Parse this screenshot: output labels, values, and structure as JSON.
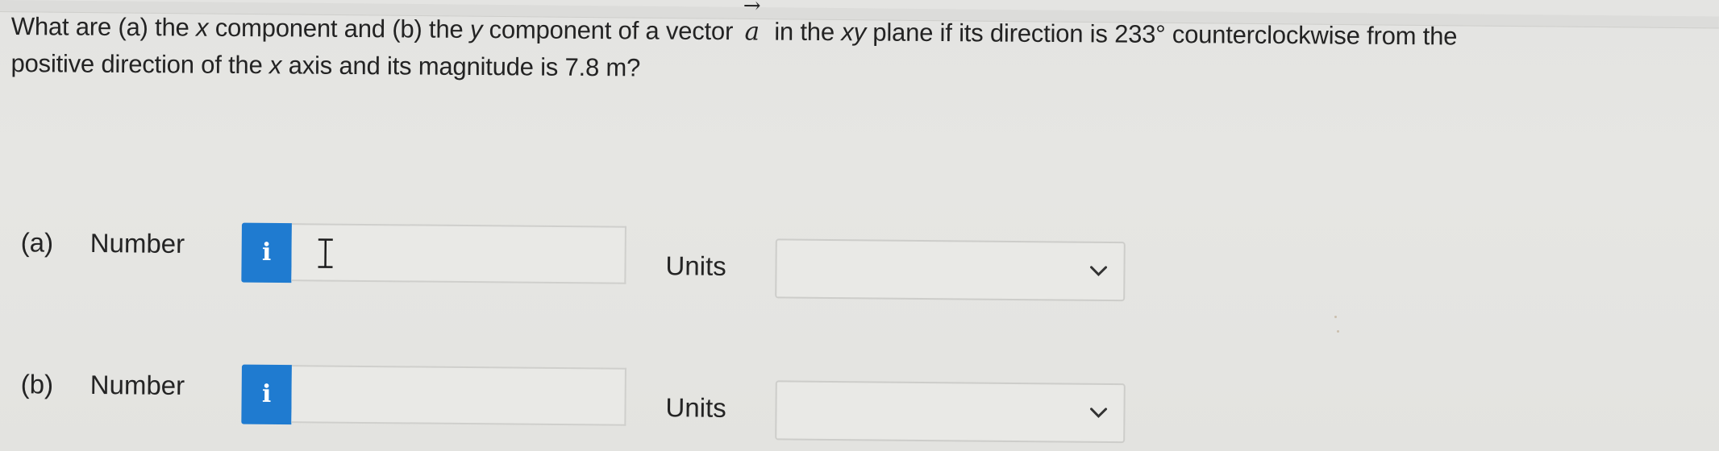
{
  "question": {
    "line1_parts": {
      "p1": "What are (a) the ",
      "x1": "x",
      "p2": " component and (b) the ",
      "y1": "y",
      "p3": " component of a vector",
      "vector_symbol": "a",
      "vector_arrow": "→",
      "p4": " in the ",
      "xy": "xy",
      "p5": " plane if its direction is 233° counterclockwise from the"
    },
    "line2_parts": {
      "p1": "positive direction of the ",
      "x2": "x",
      "p2": " axis and its magnitude is 7.8 m?"
    }
  },
  "answers": [
    {
      "part_label": "(a)",
      "number_label": "Number",
      "info_icon_glyph": "i",
      "number_value": "",
      "units_label": "Units",
      "units_selected": ""
    },
    {
      "part_label": "(b)",
      "number_label": "Number",
      "info_icon_glyph": "i",
      "number_value": "",
      "units_label": "Units",
      "units_selected": ""
    }
  ],
  "colors": {
    "info_button": "#1f7bd0",
    "background": "#e5e5e2",
    "text": "#232323"
  }
}
